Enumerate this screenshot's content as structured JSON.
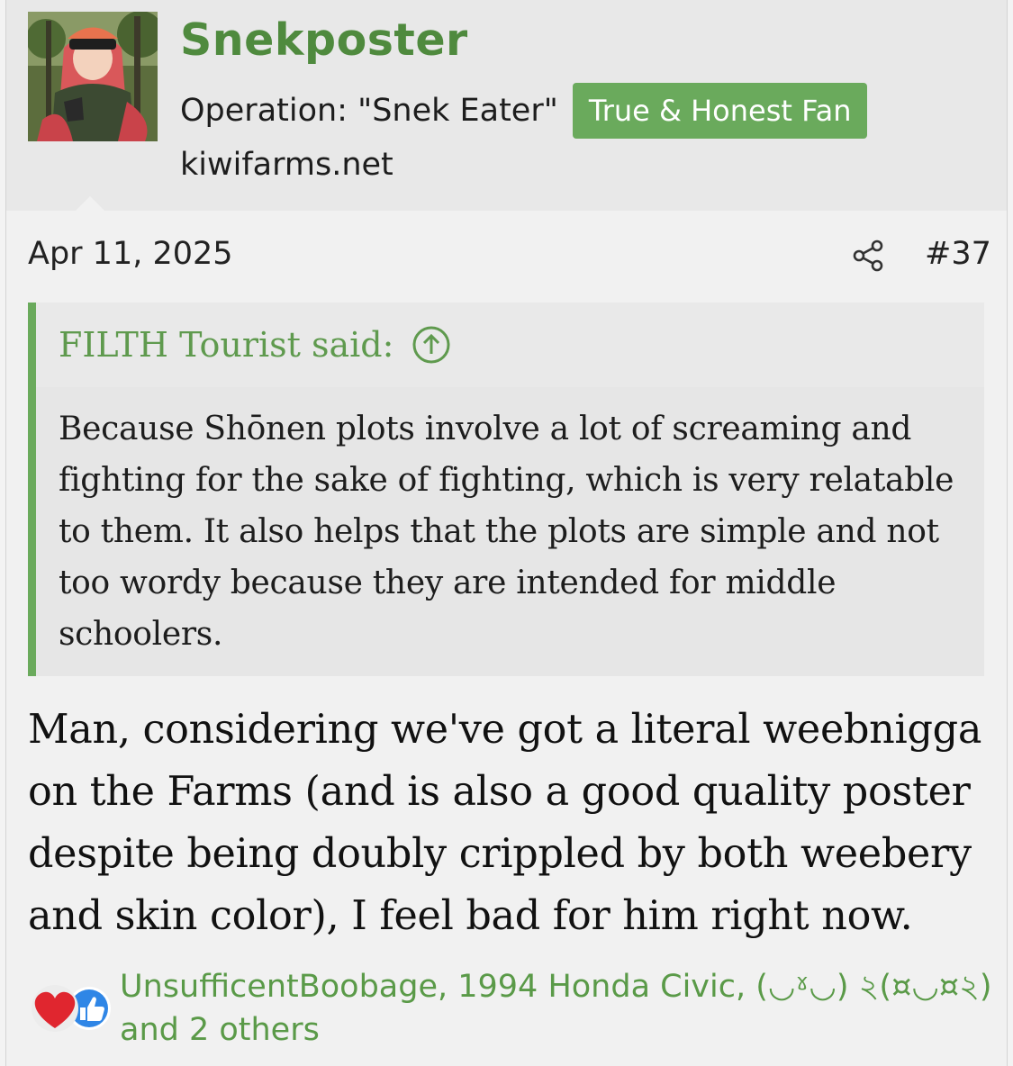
{
  "user": {
    "username": "Snekposter",
    "title": "Operation: \"Snek Eater\"",
    "banner": "True & Honest Fan",
    "site": "kiwifarms.net"
  },
  "post": {
    "date": "Apr 11, 2025",
    "number": "#37"
  },
  "quote": {
    "author": "FILTH Tourist said:",
    "text": "Because Shōnen plots involve a lot of screaming and fighting for the sake of fighting, which is very relatable to them. It also helps that the plots are simple and not too wordy because they are intended for middle schoolers."
  },
  "message": {
    "text": "Man, considering we've got a literal weebnigga on the Farms (and is also a good quality poster despite being doubly crippled by both weebery and skin color), I feel bad for him right now."
  },
  "reactions": {
    "icons": [
      "heart-icon",
      "thumbs-up-icon"
    ],
    "line1": "UnsufficentBoobage, 1994 Honda Civic, (◡ˠ◡) ২(¤◡¤২)",
    "line2": "and 2 others"
  },
  "colors": {
    "username": "#4f8a3e",
    "banner_bg": "#6aaa5c",
    "quote_bar": "#6aaa5c",
    "link": "#5a9a48"
  }
}
